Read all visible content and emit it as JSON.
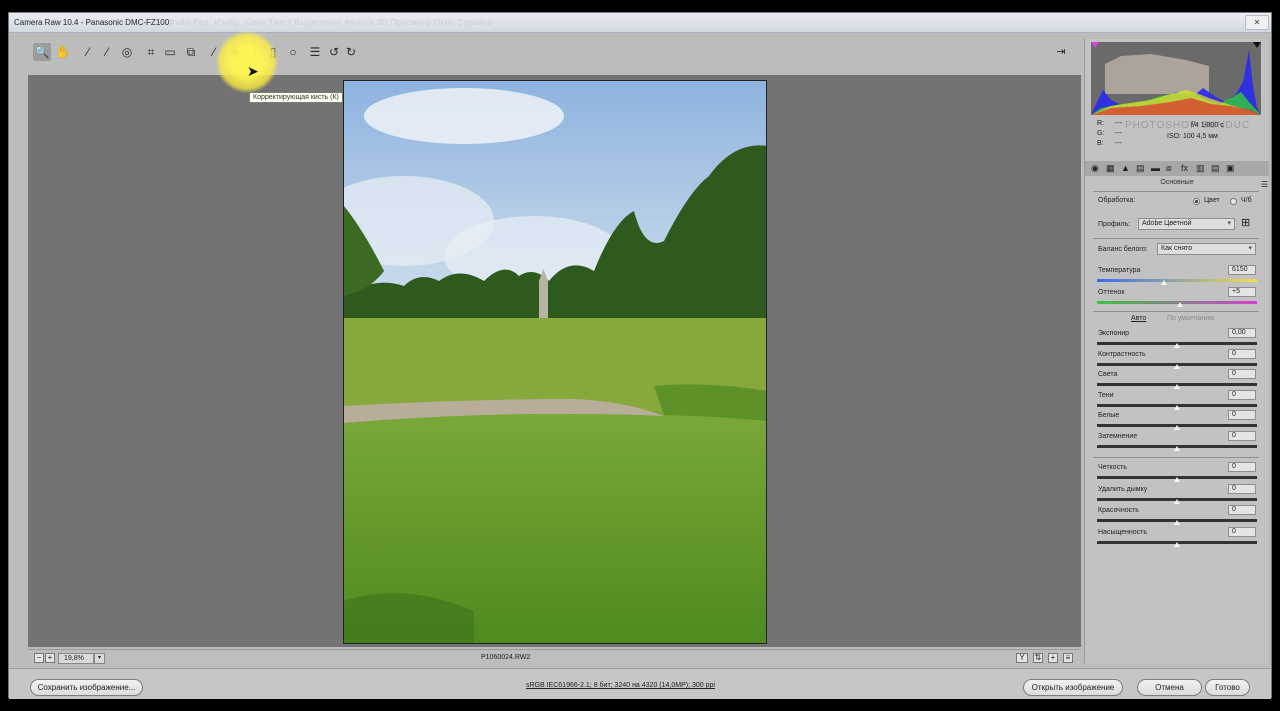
{
  "window": {
    "title": "Camera Raw 10.4  -  Panasonic DMC-FZ100",
    "menu_ghost": "Файл  Ред.  Изобр.  Слои  Текст  Выделение  Фильтр  3D  Просмотр  Окно  Справка"
  },
  "toolbar": {
    "tools": [
      {
        "name": "zoom-tool-icon",
        "glyph": "🔍"
      },
      {
        "name": "hand-tool-icon",
        "glyph": "✋"
      },
      {
        "name": "white-balance-tool-icon",
        "glyph": "⁄"
      },
      {
        "name": "color-sampler-tool-icon",
        "glyph": "⁄"
      },
      {
        "name": "targeted-adjustment-tool-icon",
        "glyph": "◎"
      },
      {
        "name": "crop-tool-icon",
        "glyph": "⌗"
      },
      {
        "name": "straighten-tool-icon",
        "glyph": "▭"
      },
      {
        "name": "transform-tool-icon",
        "glyph": "⧉"
      },
      {
        "name": "spot-removal-tool-icon",
        "glyph": "⁄"
      },
      {
        "name": "red-eye-tool-icon",
        "glyph": "◉"
      },
      {
        "name": "adjustment-brush-icon",
        "glyph": "/"
      },
      {
        "name": "graduated-filter-icon",
        "glyph": "▯"
      },
      {
        "name": "radial-filter-icon",
        "glyph": "○"
      },
      {
        "name": "preferences-icon",
        "glyph": "☰"
      },
      {
        "name": "rotate-left-icon",
        "glyph": "↺"
      },
      {
        "name": "rotate-right-icon",
        "glyph": "↻"
      }
    ],
    "tooltip": "Корректирующая кисть (К)"
  },
  "bottom_bar": {
    "zoom": "19,8%",
    "filename": "P1060024.RW2"
  },
  "footer": {
    "save_label": "Сохранить изображение...",
    "workflow_info": "sRGB IEC61966-2.1; 8 бит; 3240 на 4320 (14,0MP); 300 ppi",
    "open_label": "Открыть изображение",
    "cancel_label": "Отмена",
    "done_label": "Готово"
  },
  "panel": {
    "readout": {
      "r": "R:",
      "g": "G:",
      "b": "B:",
      "dash": "---",
      "exposure_info": "f/4  1/800 с",
      "iso_info": "ISO: 100   4,5 мм"
    },
    "watermark": "PHOTOSHOP SUNDUC",
    "section_title": "Основные",
    "treatment_label": "Обработка:",
    "treatment_color": "Цвет",
    "treatment_bw": "Ч/б",
    "profile_label": "Профиль:",
    "profile_value": "Adobe Цветной",
    "wb_label": "Баланс белого:",
    "wb_value": "Как снято",
    "auto_label": "Авто",
    "default_label": "По умолчанию",
    "sliders": [
      {
        "label": "Температура",
        "value": "6150",
        "position": 0.42
      },
      {
        "label": "Оттенок",
        "value": "+5",
        "position": 0.52
      },
      {
        "label": "Экспонир",
        "value": "0,00",
        "position": 0.5
      },
      {
        "label": "Контрастность",
        "value": "0",
        "position": 0.5
      },
      {
        "label": "Света",
        "value": "0",
        "position": 0.5
      },
      {
        "label": "Тени",
        "value": "0",
        "position": 0.5
      },
      {
        "label": "Белые",
        "value": "0",
        "position": 0.5
      },
      {
        "label": "Затемнение",
        "value": "0",
        "position": 0.5
      },
      {
        "label": "Четкость",
        "value": "0",
        "position": 0.5
      },
      {
        "label": "Удалить дымку",
        "value": "0",
        "position": 0.5
      },
      {
        "label": "Красочность",
        "value": "0",
        "position": 0.5
      },
      {
        "label": "Насыщенность",
        "value": "0",
        "position": 0.5
      }
    ]
  },
  "colors": {
    "canvas": "#737373",
    "highlight": "#fff650",
    "sky": "#a9c4e6",
    "grass": "#6fa52f"
  }
}
